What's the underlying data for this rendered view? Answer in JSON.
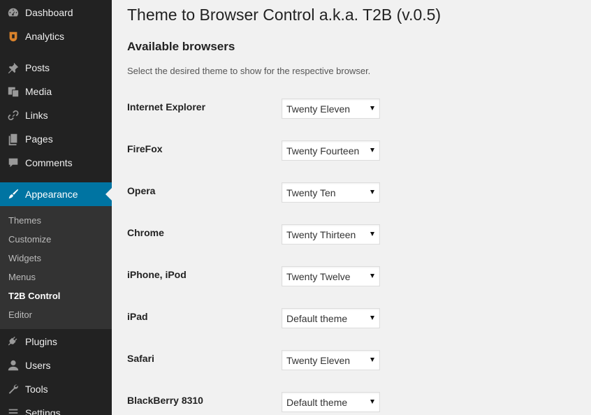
{
  "sidebar": {
    "items": [
      {
        "label": "Dashboard",
        "icon": "dashboard-icon"
      },
      {
        "label": "Analytics",
        "icon": "analytics-icon"
      },
      {
        "label": "Posts",
        "icon": "pushpin-icon"
      },
      {
        "label": "Media",
        "icon": "media-icon"
      },
      {
        "label": "Links",
        "icon": "link-icon"
      },
      {
        "label": "Pages",
        "icon": "pages-icon"
      },
      {
        "label": "Comments",
        "icon": "comment-icon"
      },
      {
        "label": "Appearance",
        "icon": "paintbrush-icon"
      },
      {
        "label": "Plugins",
        "icon": "plugin-icon"
      },
      {
        "label": "Users",
        "icon": "user-icon"
      },
      {
        "label": "Tools",
        "icon": "wrench-icon"
      },
      {
        "label": "Settings",
        "icon": "settings-icon"
      }
    ],
    "submenu": [
      {
        "label": "Themes"
      },
      {
        "label": "Customize"
      },
      {
        "label": "Widgets"
      },
      {
        "label": "Menus"
      },
      {
        "label": "T2B Control"
      },
      {
        "label": "Editor"
      }
    ]
  },
  "main": {
    "title": "Theme to Browser Control a.k.a. T2B (v.0.5)",
    "section_title": "Available browsers",
    "description": "Select the desired theme to show for the respective browser.",
    "rows": [
      {
        "label": "Internet Explorer",
        "value": "Twenty Eleven"
      },
      {
        "label": "FireFox",
        "value": "Twenty Fourteen"
      },
      {
        "label": "Opera",
        "value": "Twenty Ten"
      },
      {
        "label": "Chrome",
        "value": "Twenty Thirteen"
      },
      {
        "label": "iPhone, iPod",
        "value": "Twenty Twelve"
      },
      {
        "label": "iPad",
        "value": "Default theme"
      },
      {
        "label": "Safari",
        "value": "Twenty Eleven"
      },
      {
        "label": "BlackBerry 8310",
        "value": "Default theme"
      }
    ]
  },
  "colors": {
    "sidebar_bg": "#222222",
    "submenu_bg": "#333333",
    "current_bg": "#0074a2",
    "page_bg": "#f1f1f1",
    "analytics_icon": "#d9822b"
  }
}
